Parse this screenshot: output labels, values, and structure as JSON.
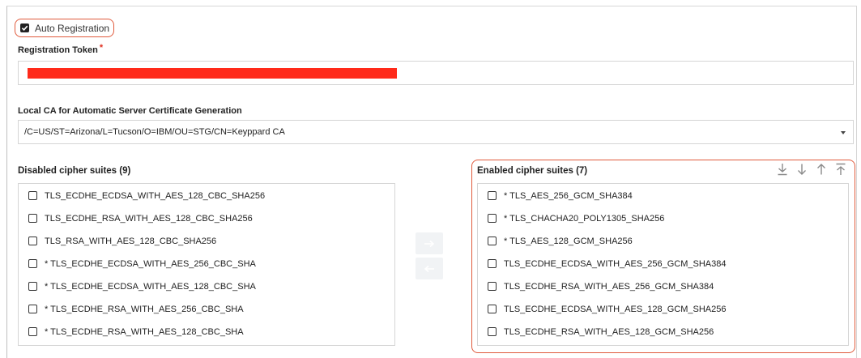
{
  "auto_registration": {
    "label": "Auto Registration",
    "checked": true
  },
  "registration_token": {
    "label": "Registration Token",
    "required_mark": "*",
    "value_redacted": true
  },
  "local_ca": {
    "label": "Local CA for Automatic Server Certificate Generation",
    "selected": "/C=US/ST=Arizona/L=Tucson/O=IBM/OU=STG/CN=Keyppard CA"
  },
  "disabled_suites": {
    "title": "Disabled cipher suites (9)",
    "items": [
      "TLS_ECDHE_ECDSA_WITH_AES_128_CBC_SHA256",
      "TLS_ECDHE_RSA_WITH_AES_128_CBC_SHA256",
      "TLS_RSA_WITH_AES_128_CBC_SHA256",
      "* TLS_ECDHE_ECDSA_WITH_AES_256_CBC_SHA",
      "* TLS_ECDHE_ECDSA_WITH_AES_128_CBC_SHA",
      "* TLS_ECDHE_RSA_WITH_AES_256_CBC_SHA",
      "* TLS_ECDHE_RSA_WITH_AES_128_CBC_SHA"
    ]
  },
  "enabled_suites": {
    "title": "Enabled cipher suites (7)",
    "items": [
      "* TLS_AES_256_GCM_SHA384",
      "* TLS_CHACHA20_POLY1305_SHA256",
      "* TLS_AES_128_GCM_SHA256",
      "TLS_ECDHE_ECDSA_WITH_AES_256_GCM_SHA384",
      "TLS_ECDHE_RSA_WITH_AES_256_GCM_SHA384",
      "TLS_ECDHE_ECDSA_WITH_AES_128_GCM_SHA256",
      "TLS_ECDHE_RSA_WITH_AES_128_GCM_SHA256"
    ]
  },
  "move_buttons": {
    "right_icon": "arrow-right-icon",
    "left_icon": "arrow-left-icon"
  },
  "toolbar_icons": [
    "move-to-bottom-icon",
    "move-down-icon",
    "move-up-icon",
    "move-to-top-icon"
  ],
  "colors": {
    "highlight": "#e05a3c",
    "redaction": "#ff2a1a",
    "required": "#e03020"
  }
}
